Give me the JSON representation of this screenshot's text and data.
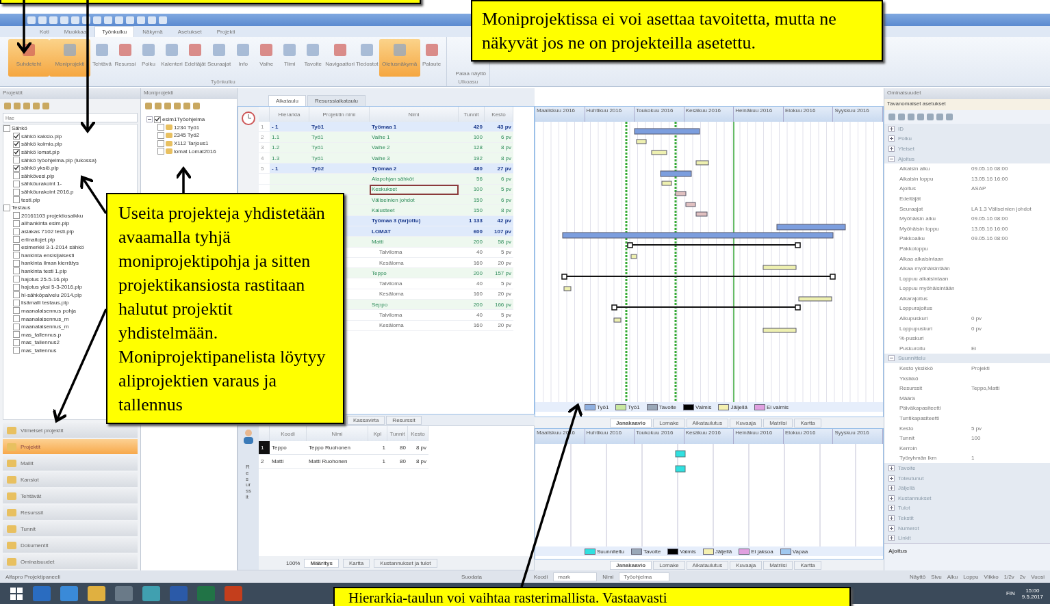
{
  "ribbon": {
    "tabs": [
      {
        "label": "Koti",
        "selected": false
      },
      {
        "label": "Muokkaa",
        "selected": false
      },
      {
        "label": "Työnkulku",
        "selected": true
      },
      {
        "label": "Näkymä",
        "selected": false
      },
      {
        "label": "Asetukset",
        "selected": false
      },
      {
        "label": "Projekti",
        "selected": false
      }
    ],
    "buttons": [
      {
        "label": "Suhdeteht",
        "on": true
      },
      {
        "label": "Moniprojekti",
        "on": true
      },
      {
        "label": "Tehtävä",
        "on": false
      },
      {
        "label": "Resurssi",
        "on": false
      },
      {
        "label": "Polku",
        "on": false
      },
      {
        "label": "Kalenteri",
        "on": false
      },
      {
        "label": "Edeltäjät",
        "on": false
      },
      {
        "label": "Seuraajat",
        "on": false
      },
      {
        "label": "Info",
        "on": false
      },
      {
        "label": "Vaihe",
        "on": false
      },
      {
        "label": "Tiimi",
        "on": false
      },
      {
        "label": "Tavoite",
        "on": false
      },
      {
        "label": "Navigaattori",
        "on": false
      },
      {
        "label": "Tiedostot",
        "on": false
      },
      {
        "label": "Oletusnäkymä",
        "on": true
      },
      {
        "label": "Palaute",
        "on": false
      }
    ],
    "group_label": "Työnkulku",
    "side_button": "Palaa näyttö",
    "side_group": "Ulkoasu"
  },
  "projects_panel": {
    "title": "Projektit",
    "search_placeholder": "Hae",
    "tree": [
      {
        "label": "Sähkö",
        "checked": false,
        "children": [
          {
            "label": "sähkö kaksio.plp",
            "checked": true
          },
          {
            "label": "sähkö kolmio.plp",
            "checked": true
          },
          {
            "label": "sähkö lomat.plp",
            "checked": true
          },
          {
            "label": "sähkö työohjelma.plp (lukossa)",
            "checked": false
          },
          {
            "label": "sähkö yksiö.plp",
            "checked": true
          },
          {
            "label": "sähkövesi.plp",
            "checked": false
          },
          {
            "label": "sähköurakoint 1-",
            "checked": false
          },
          {
            "label": "sähköurakoint 2016.p",
            "checked": false
          },
          {
            "label": "testi.plp",
            "checked": false
          }
        ]
      },
      {
        "label": "Testaus",
        "checked": false,
        "children": [
          {
            "label": "20161103 projektiosaikku",
            "checked": false
          },
          {
            "label": "alihankinta esim.plp",
            "checked": false
          },
          {
            "label": "asiakas 7102 testi.plp",
            "checked": false
          },
          {
            "label": "erlinaitojet.plp",
            "checked": false
          },
          {
            "label": "esimerkki 3-1-2014 sähkö",
            "checked": false
          },
          {
            "label": "hankinta ensisijaisesti",
            "checked": false
          },
          {
            "label": "hankinta ilman kierrätys",
            "checked": false
          },
          {
            "label": "hankinta testi 1.plp",
            "checked": false
          },
          {
            "label": "hajotus 25-5-16.plp",
            "checked": false
          },
          {
            "label": "hajotus yksi 5-3-2016.plp",
            "checked": false
          },
          {
            "label": "hl-sähköpalvelu 2014.plp",
            "checked": false
          },
          {
            "label": "lisämalli testaus.plp",
            "checked": false
          },
          {
            "label": "maanalaisennus pohja",
            "checked": false
          },
          {
            "label": "maanalaisennus_m",
            "checked": false
          },
          {
            "label": "maanalaisennus_m",
            "checked": false
          },
          {
            "label": "mas_tallennus.p",
            "checked": false
          },
          {
            "label": "mas_tallennus2",
            "checked": false
          },
          {
            "label": "mas_tallennus",
            "checked": false
          }
        ]
      }
    ],
    "nav": [
      {
        "label": "Viimeiset projektit",
        "selected": false
      },
      {
        "label": "Projektit",
        "selected": true
      },
      {
        "label": "Mallit",
        "selected": false
      },
      {
        "label": "Kansiot",
        "selected": false
      },
      {
        "label": "Tehtävät",
        "selected": false
      },
      {
        "label": "Resurssit",
        "selected": false
      },
      {
        "label": "Tunnit",
        "selected": false
      },
      {
        "label": "Dokumentit",
        "selected": false
      },
      {
        "label": "Ominaisuudet",
        "selected": false
      }
    ]
  },
  "multi_panel": {
    "title": "Moniprojekti",
    "root": {
      "label": "esim1Työohjelma",
      "checked": true,
      "expanded": true
    },
    "children": [
      {
        "code": "1234",
        "label": "Työ1",
        "checked": false
      },
      {
        "code": "2345",
        "label": "Työ2",
        "checked": false
      },
      {
        "code": "X112",
        "label": "Tarjous1",
        "checked": false
      },
      {
        "code": "lomat",
        "label": "Lomat2016",
        "checked": false
      }
    ]
  },
  "center_tabs": [
    {
      "label": "Aikataulu",
      "selected": true
    },
    {
      "label": "Resurssiaikataulu",
      "selected": false
    }
  ],
  "task_table": {
    "columns": [
      "Hierarkia",
      "Projektin nimi",
      "Nimi",
      "Tunnit",
      "Kesto"
    ],
    "rows": [
      {
        "num": "1",
        "h": "- 1",
        "p": "Työ1",
        "n": "Työmaa 1",
        "t": "420",
        "k": "43 pv",
        "kind": "summary",
        "selected": false
      },
      {
        "num": "2",
        "h": "1.1",
        "p": "Työ1",
        "n": "Vaihe 1",
        "t": "100",
        "k": "6 pv",
        "kind": "task",
        "selected": false
      },
      {
        "num": "3",
        "h": "1.2",
        "p": "Työ1",
        "n": "Vaihe 2",
        "t": "128",
        "k": "8 pv",
        "kind": "task",
        "selected": false
      },
      {
        "num": "4",
        "h": "1.3",
        "p": "Työ1",
        "n": "Vaihe 3",
        "t": "192",
        "k": "8 pv",
        "kind": "task",
        "selected": false
      },
      {
        "num": "5",
        "h": "- 1",
        "p": "Työ2",
        "n": "Työmaa 2",
        "t": "480",
        "k": "27 pv",
        "kind": "summary",
        "selected": false
      },
      {
        "n": "Alapohjan sähköt",
        "t": "56",
        "k": "6 pv",
        "kind": "task",
        "selected": false
      },
      {
        "n": "Keskukset",
        "t": "100",
        "k": "5 pv",
        "kind": "task",
        "selected": true
      },
      {
        "n": "Väliseinien johdot",
        "t": "150",
        "k": "6 pv",
        "kind": "task",
        "selected": false
      },
      {
        "n": "Kalusteet",
        "t": "150",
        "k": "8 pv",
        "kind": "task",
        "selected": false
      },
      {
        "n": "Työmaa 3 (tarjottu)",
        "t": "1 133",
        "k": "42 pv",
        "kind": "summary",
        "selected": false
      },
      {
        "n": "LOMAT",
        "t": "600",
        "k": "107 pv",
        "kind": "summary",
        "selected": false
      },
      {
        "n": "Matti",
        "t": "200",
        "k": "58 pv",
        "kind": "task",
        "selected": false
      },
      {
        "n": "Talviloma",
        "t": "40",
        "k": "5 pv",
        "kind": "sub",
        "selected": false
      },
      {
        "n": "Kesäloma",
        "t": "160",
        "k": "20 pv",
        "kind": "sub",
        "selected": false
      },
      {
        "n": "Teppo",
        "t": "200",
        "k": "157 pv",
        "kind": "task",
        "selected": false
      },
      {
        "n": "Talviloma",
        "t": "40",
        "k": "5 pv",
        "kind": "sub",
        "selected": false
      },
      {
        "n": "Kesäloma",
        "t": "160",
        "k": "20 pv",
        "kind": "sub",
        "selected": false
      },
      {
        "n": "Seppo",
        "t": "200",
        "k": "166 pv",
        "kind": "task",
        "selected": false
      },
      {
        "n": "Talviloma",
        "t": "40",
        "k": "5 pv",
        "kind": "sub",
        "selected": false
      },
      {
        "n": "Kesäloma",
        "t": "160",
        "k": "20 pv",
        "kind": "sub",
        "selected": false
      }
    ],
    "bottom_tabs": [
      {
        "label": "Kassavirta",
        "selected": false
      },
      {
        "label": "Resurssit",
        "selected": false
      }
    ]
  },
  "resource_table": {
    "side_label": "Resurssit",
    "columns": [
      "Koodi",
      "Nimi",
      "Kpl",
      "Tunnit",
      "Kesto"
    ],
    "rows": [
      {
        "num": "1",
        "code": "Teppo",
        "name": "Teppo Ruohonen",
        "qty": "1",
        "hours": "80",
        "dur": "8 pv",
        "selected": true
      },
      {
        "num": "2",
        "code": "Matti",
        "name": "Matti Ruohonen",
        "qty": "1",
        "hours": "80",
        "dur": "8 pv",
        "selected": false
      }
    ],
    "zoom": "100%",
    "bottom_tabs": [
      {
        "label": "Määritys",
        "selected": true
      },
      {
        "label": "Kartta",
        "selected": false
      },
      {
        "label": "Kustannukset ja tulot",
        "selected": false
      }
    ]
  },
  "gantt": {
    "months": [
      "Maaliskuu 2016",
      "Huhtikuu 2016",
      "Toukokuu 2016",
      "Kesäkuu 2016",
      "Heinäkuu 2016",
      "Elokuu 2016",
      "Syyskuu 2016"
    ],
    "legend": [
      {
        "label": "Työ1",
        "color": "#8fb0e0"
      },
      {
        "label": "Työ1",
        "color": "#c8e8a0"
      },
      {
        "label": "Tavoite",
        "color": "#9aa8b8"
      },
      {
        "label": "Valmis",
        "color": "#000000"
      },
      {
        "label": "Jäljellä",
        "color": "#f4f0b0"
      },
      {
        "label": "Ei valmis",
        "color": "#e0a0e0"
      }
    ],
    "tabs": [
      {
        "label": "Janakaavio",
        "selected": true
      },
      {
        "label": "Lomake",
        "selected": false
      },
      {
        "label": "Aikataulutus",
        "selected": false
      },
      {
        "label": "Kuvaaja",
        "selected": false
      },
      {
        "label": "Matriisi",
        "selected": false
      },
      {
        "label": "Kartta",
        "selected": false
      }
    ]
  },
  "resource_gantt": {
    "months": [
      "Maaliskuu 2016",
      "Huhtikuu 2016",
      "Toukokuu 2016",
      "Kesäkuu 2016",
      "Heinäkuu 2016",
      "Elokuu 2016",
      "Syyskuu 2016"
    ],
    "legend": [
      {
        "label": "Suunniteltu",
        "color": "#30e0e0"
      },
      {
        "label": "Tavoite",
        "color": "#9aa8b8"
      },
      {
        "label": "Valmis",
        "color": "#000000"
      },
      {
        "label": "Jäljellä",
        "color": "#f4f0b0"
      },
      {
        "label": "Ei jaksoa",
        "color": "#e0a0e0"
      },
      {
        "label": "Vapaa",
        "color": "#a0c8f0"
      }
    ],
    "tabs": [
      {
        "label": "Janakaavio",
        "selected": true
      },
      {
        "label": "Lomake",
        "selected": false
      },
      {
        "label": "Aikataulutus",
        "selected": false
      },
      {
        "label": "Kuvaaja",
        "selected": false
      },
      {
        "label": "Matriisi",
        "selected": false
      },
      {
        "label": "Kartta",
        "selected": false
      }
    ]
  },
  "properties": {
    "title": "Ominaisuudet",
    "subtitle": "Tavanomaiset asetukset",
    "rows": [
      {
        "kind": "group",
        "label": "ID",
        "expanded": false
      },
      {
        "kind": "group",
        "label": "Polku",
        "expanded": false
      },
      {
        "kind": "group",
        "label": "Yleiset",
        "expanded": false
      },
      {
        "kind": "group",
        "label": "Ajoitus",
        "expanded": true
      },
      {
        "kind": "prop",
        "label": "Aikaisin alku",
        "value": "09.05.16 08:00"
      },
      {
        "kind": "prop",
        "label": "Aikaisin loppu",
        "value": "13.05.16 16:00"
      },
      {
        "kind": "prop",
        "label": "Ajoitus",
        "value": "ASAP"
      },
      {
        "kind": "prop",
        "label": "Edeltäjät"
      },
      {
        "kind": "prop",
        "label": "Seuraajat",
        "value": "LA 1.3 Väliseinien johdot"
      },
      {
        "kind": "prop",
        "label": "Myöhäisin alku",
        "value": "09.05.16 08:00"
      },
      {
        "kind": "prop",
        "label": "Myöhäisin loppu",
        "value": "13.05.16 16:00"
      },
      {
        "kind": "prop",
        "label": "Pakkoalku",
        "value": "09.05.16 08:00"
      },
      {
        "kind": "prop",
        "label": "Pakkoloppu"
      },
      {
        "kind": "prop",
        "label": "Alkaa aikaisintaan"
      },
      {
        "kind": "prop",
        "label": "Alkaa myöhäisintään"
      },
      {
        "kind": "prop",
        "label": "Loppuu aikaisintaan"
      },
      {
        "kind": "prop",
        "label": "Loppuu myöhäisintään"
      },
      {
        "kind": "prop",
        "label": "Aikarajoitus"
      },
      {
        "kind": "prop",
        "label": "Loppurajoitus"
      },
      {
        "kind": "prop",
        "label": "Alkupuskuri",
        "value": "0 pv"
      },
      {
        "kind": "prop",
        "label": "Loppupuskuri",
        "value": "0 pv"
      },
      {
        "kind": "prop",
        "label": "%-puskuri"
      },
      {
        "kind": "prop",
        "label": "Puskuroitu",
        "value": "Ei"
      },
      {
        "kind": "group",
        "label": "Suunnittelu",
        "expanded": true
      },
      {
        "kind": "prop",
        "label": "Kesto yksikkö",
        "value": "Projekti"
      },
      {
        "kind": "prop",
        "label": "Yksikkö"
      },
      {
        "kind": "prop",
        "label": "Resurssit",
        "value": "Teppo,Matti"
      },
      {
        "kind": "prop",
        "label": "Määrä"
      },
      {
        "kind": "prop",
        "label": "Päiväkapasiteetti"
      },
      {
        "kind": "prop",
        "label": "Tuntikapasiteetti"
      },
      {
        "kind": "prop",
        "label": "Kesto",
        "value": "5 pv"
      },
      {
        "kind": "prop",
        "label": "Tunnit",
        "value": "100"
      },
      {
        "kind": "prop",
        "label": "Kerroin"
      },
      {
        "kind": "prop",
        "label": "Työryhmän lkm",
        "value": "1"
      },
      {
        "kind": "group",
        "label": "Tavoite",
        "expanded": false
      },
      {
        "kind": "group",
        "label": "Toteutunut",
        "expanded": false
      },
      {
        "kind": "group",
        "label": "Jäljellä",
        "expanded": false
      },
      {
        "kind": "group",
        "label": "Kustannukset",
        "expanded": false
      },
      {
        "kind": "group",
        "label": "Tulot",
        "expanded": false
      },
      {
        "kind": "group",
        "label": "Tekstit",
        "expanded": false
      },
      {
        "kind": "group",
        "label": "Numerot",
        "expanded": false
      },
      {
        "kind": "group",
        "label": "Linkit",
        "expanded": false
      }
    ],
    "footer": "Ajoitus"
  },
  "status_bar": {
    "app": "Alfapro Projektipaneeli",
    "filter": "Suodata",
    "code_label": "Koodi",
    "code": "mark",
    "name_label": "Nimi",
    "name": "Työohjelma",
    "right": [
      "Näyttö",
      "Sivu",
      "Alku",
      "Loppu",
      "Viikko",
      "1/2v",
      "2v",
      "Vuosi"
    ]
  },
  "taskbar": {
    "lang": "FIN",
    "time": "15:00",
    "date": "9.5.2017"
  },
  "callouts": {
    "top": "Moniprojektissa ei voi asettaa tavoitetta, mutta ne näkyvät jos ne on projekteilla asetettu.",
    "left": "Useita projekteja yhdistetään avaamalla tyhjä moniprojektipohja ja sitten projektikansiosta rastitaan halutut projektit yhdistelmään. Moniprojektipanelista löytyy aliprojektien varaus ja tallennus",
    "bottom": "Hierarkia-taulun voi vaihtaa rasterimallista. Vastaavasti"
  }
}
